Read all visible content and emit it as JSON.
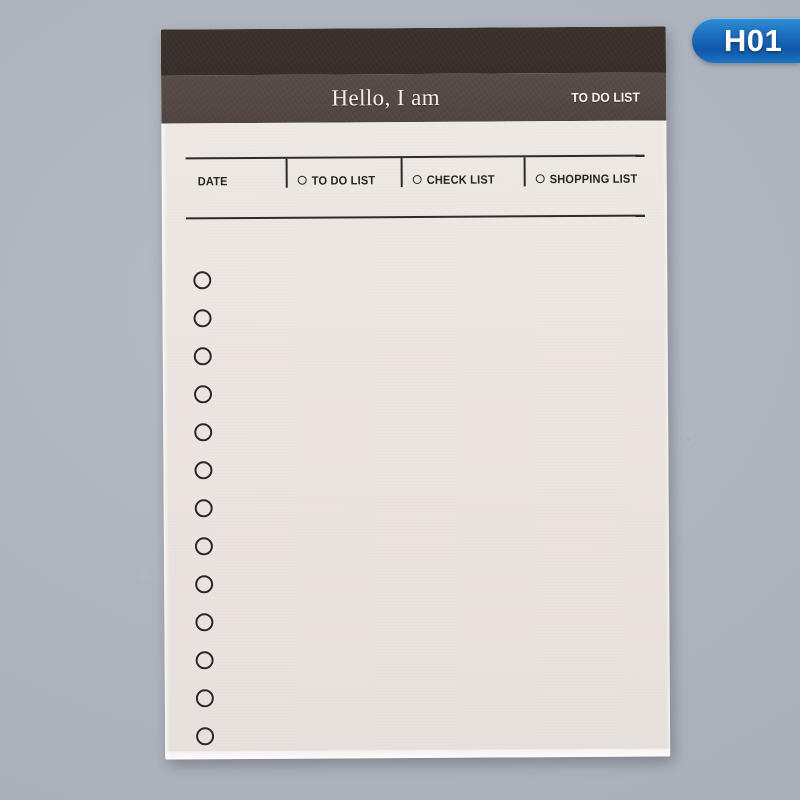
{
  "scene": {
    "background_color": "#b1b6c0",
    "description": "Product photo of a to-do list notepad on a gray surface"
  },
  "badge": {
    "label": "H01",
    "background_color": "#1f6fc0",
    "text_color": "#ffffff"
  },
  "notepad": {
    "header": {
      "dark_band_color": "#3a302c",
      "mid_band_color": "#544943",
      "title": "Hello, I am",
      "tag": "TO DO LIST"
    },
    "paper_color": "#ece5e1",
    "ink_color": "#2e2b28",
    "columns": [
      {
        "label": "DATE",
        "has_circle": false
      },
      {
        "label": "TO DO LIST",
        "has_circle": true
      },
      {
        "label": "CHECK LIST",
        "has_circle": true
      },
      {
        "label": "SHOPPING LIST",
        "has_circle": true
      }
    ],
    "bullet_count": 13
  }
}
